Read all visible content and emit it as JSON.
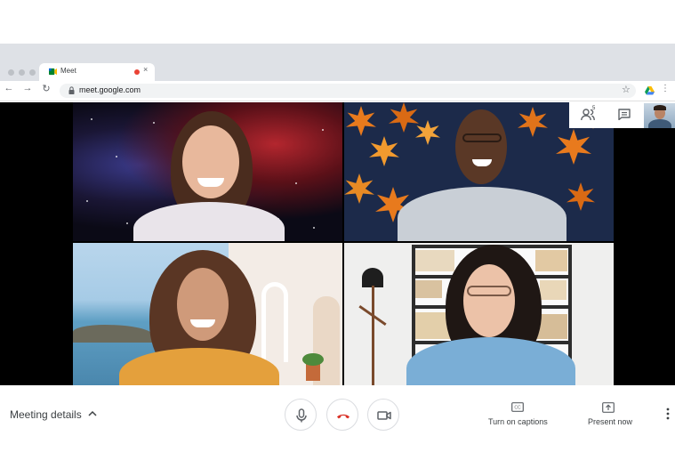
{
  "browser": {
    "tab_title": "Meet",
    "tab_close": "×",
    "url": "meet.google.com",
    "nav": {
      "back": "←",
      "forward": "→",
      "reload": "↻"
    },
    "star": "☆",
    "menu": "⋮"
  },
  "meet_top": {
    "people_count": "5",
    "icons": [
      "people-icon",
      "chat-icon"
    ]
  },
  "participants": [
    {
      "background": "galaxy",
      "name": ""
    },
    {
      "background": "autumn-leaves",
      "name": ""
    },
    {
      "background": "beach-room",
      "name": ""
    },
    {
      "background": "bookshelf-room",
      "name": ""
    }
  ],
  "bottom_bar": {
    "meeting_details": "Meeting details",
    "captions_label": "Turn on captions",
    "present_label": "Present now",
    "buttons": [
      "microphone",
      "end-call",
      "camera"
    ]
  },
  "colors": {
    "end_call": "#d93025",
    "icon_gray": "#5f6368",
    "text": "#3c4043"
  }
}
